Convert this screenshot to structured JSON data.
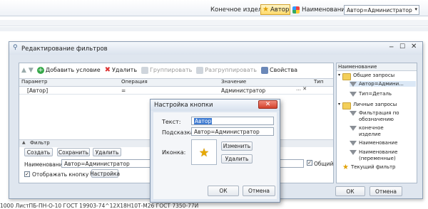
{
  "topbar": {
    "label_product": "Конечное изделие",
    "author_button": "Автор",
    "label_name": "Наименование",
    "select_value": "Автор=Администратор"
  },
  "filter_window": {
    "title": "Редактирование фильтров",
    "toolbar": {
      "add": "Добавить условие",
      "delete": "Удалить",
      "group": "Группировать",
      "ungroup": "Разгруппировать",
      "properties": "Свойства"
    },
    "grid": {
      "headers": [
        "Параметр",
        "Операция",
        "Значение",
        "Тип"
      ],
      "row": {
        "param": "[Автор]",
        "op": "=",
        "value": "Администратор"
      }
    },
    "filter_section": {
      "header": "Фильтр",
      "create": "Создать",
      "save": "Сохранить",
      "delete": "Удалить",
      "name_label": "Наименование",
      "name_value": "Автор=Администратор",
      "common_label": "Общий",
      "show_button_label": "Отображать кнопку",
      "settings": "Настройка"
    },
    "tree": {
      "header": "Наименование",
      "general_folder": "Общие запросы",
      "general_items": [
        "Автор=Админи...",
        "Тип=Деталь"
      ],
      "personal_folder": "Личные запросы",
      "personal_items": [
        "Фильтрация по обозначению",
        "конечное изделие",
        "Наименование",
        "Наименование (переменные)"
      ],
      "current": "Текущий фильтр"
    },
    "ok": "ОК",
    "cancel": "Отмена"
  },
  "button_dialog": {
    "title": "Настройка кнопки",
    "text_label": "Текст:",
    "text_value": "Автор",
    "hint_label": "Подсказка:",
    "hint_value": "Автор=Администратор",
    "icon_label": "Иконка:",
    "change": "Изменить",
    "delete": "Удалить",
    "ok": "ОК",
    "cancel": "Отмена"
  },
  "bottom_text": "1000 ЛистПБ-ПН-О-10 ГОСТ 19903-74^12Х18Н10Т-М26 ГОСТ 7350-77И"
}
